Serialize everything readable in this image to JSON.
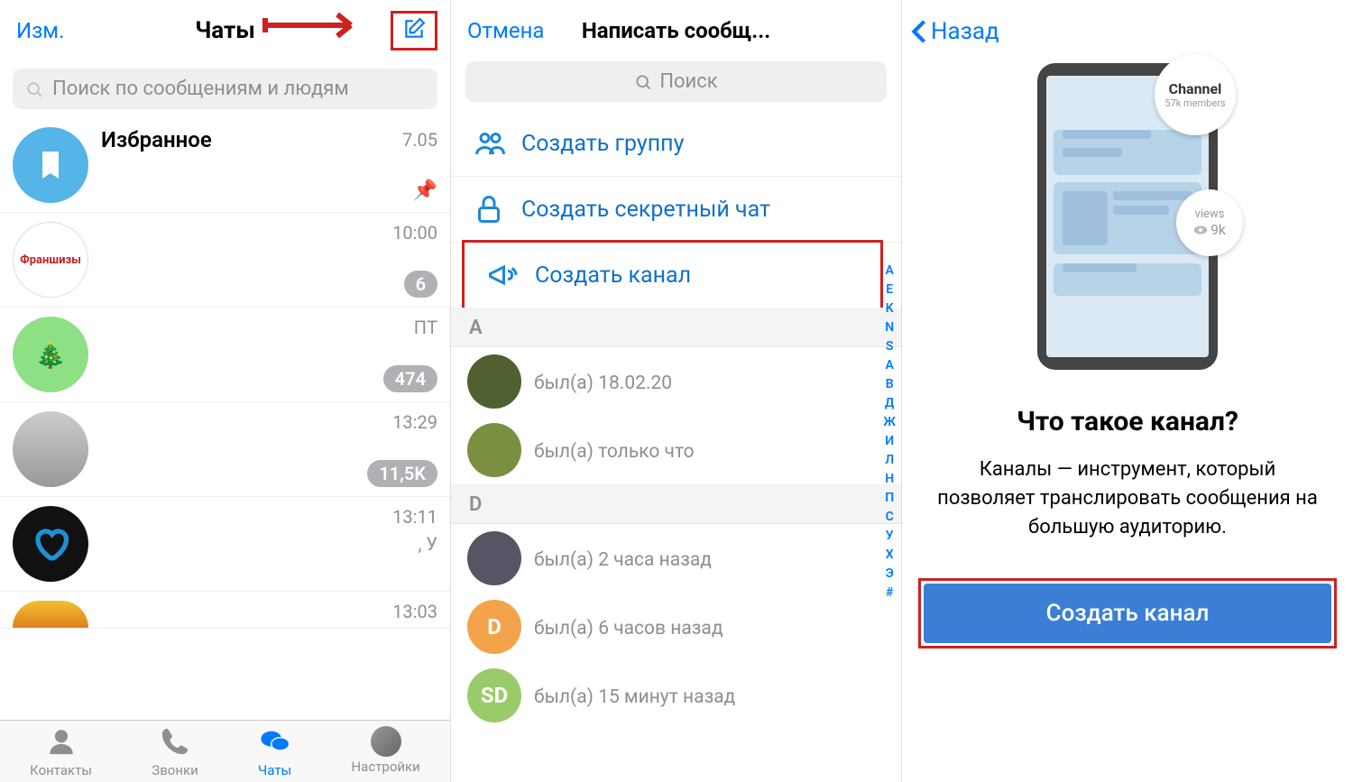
{
  "panel1": {
    "edit": "Изм.",
    "title": "Чаты",
    "search_placeholder": "Поиск по сообщениям и людям",
    "chats": [
      {
        "name": "Избранное",
        "time": "7.05",
        "pinned": true,
        "avatar_bg": "#55b4e8"
      },
      {
        "name": "",
        "time": "10:00",
        "badge": "6",
        "avatar_label": "Франшизы"
      },
      {
        "name": "",
        "time": "ПТ",
        "badge": "474",
        "avatar_bg": "#8ee085"
      },
      {
        "name": "",
        "time": "13:29",
        "badge": "11,5K",
        "avatar_bg": "#d8d8d8"
      },
      {
        "name": "",
        "time": "13:11",
        "preview": ", У",
        "avatar_bg": "#111"
      },
      {
        "name": "",
        "time": "13:03",
        "avatar_bg": "#f0a030"
      }
    ],
    "tabs": {
      "contacts": "Контакты",
      "calls": "Звонки",
      "chats": "Чаты",
      "settings": "Настройки"
    }
  },
  "panel2": {
    "cancel": "Отмена",
    "title": "Написать сообщ...",
    "search": "Поиск",
    "create_group": "Создать группу",
    "create_secret": "Создать секретный чат",
    "create_channel": "Создать канал",
    "sections": {
      "A": [
        {
          "status": "был(а) 18.02.20",
          "bg": "#506030"
        },
        {
          "status": "был(а) только что",
          "bg": "#7a9040"
        }
      ],
      "D": [
        {
          "status": "был(а) 2 часа назад",
          "bg": "#556"
        },
        {
          "status": "был(а) 6 часов назад",
          "bg": "#f5a34a",
          "initial": "D"
        },
        {
          "status": "был(а) 15 минут назад",
          "bg": "#9acb6b",
          "initial": "SD"
        }
      ]
    },
    "index": [
      "A",
      "E",
      "K",
      "N",
      "S",
      "А",
      "В",
      "Д",
      "Ж",
      "И",
      "Л",
      "Н",
      "П",
      "С",
      "У",
      "Х",
      "Э",
      "#"
    ]
  },
  "panel3": {
    "back": "Назад",
    "illustration": {
      "channel_name": "Channel",
      "channel_members": "57k members",
      "views_label": "views",
      "views_count": "9k"
    },
    "heading": "Что такое канал?",
    "description": "Каналы — инструмент, который позволяет транслировать сообщения на большую аудиторию.",
    "button": "Создать канал"
  }
}
